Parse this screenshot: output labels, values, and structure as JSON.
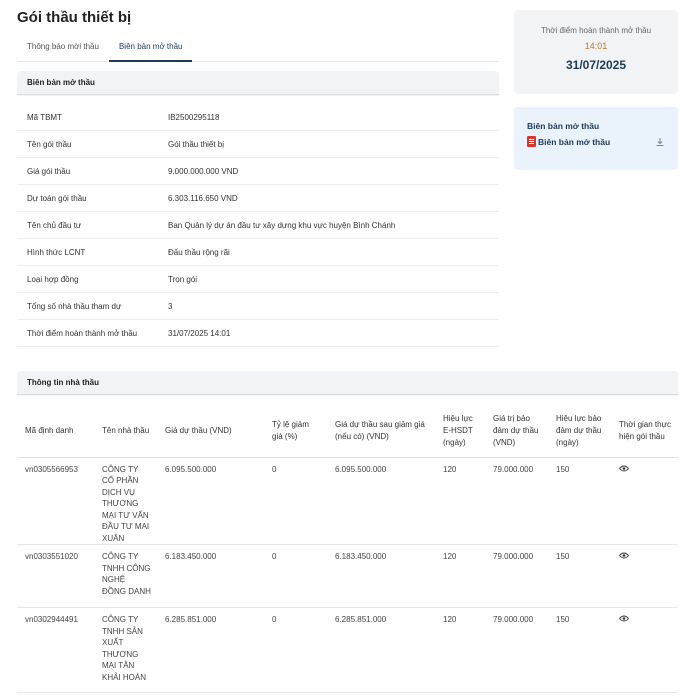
{
  "page_title": "Gói thầu thiết bị",
  "tabs": [
    {
      "label": "Thông báo mời thầu",
      "active": false
    },
    {
      "label": "Biên bản mở thầu",
      "active": true
    }
  ],
  "minutes_section": {
    "title": "Biên bản mở thầu",
    "rows": [
      {
        "label": "Mã TBMT",
        "value": "IB2500295118"
      },
      {
        "label": "Tên gói thầu",
        "value": "Gói thầu thiết bị"
      },
      {
        "label": "Giá gói thầu",
        "value": "9.000.000.000 VND"
      },
      {
        "label": "Dự toán gói thầu",
        "value": "6.303.116.650 VND"
      },
      {
        "label": "Tên chủ đầu tư",
        "value": "Ban Quản lý dự án đầu tư xây dựng khu vực huyện Bình Chánh"
      },
      {
        "label": "Hình thức LCNT",
        "value": "Đấu thầu rộng rãi"
      },
      {
        "label": "Loại hợp đồng",
        "value": "Trọn gói"
      },
      {
        "label": "Tổng số nhà thầu tham dự",
        "value": "3"
      },
      {
        "label": "Thời điểm hoàn thành mở thầu",
        "value": "31/07/2025 14:01"
      }
    ]
  },
  "completion_card": {
    "label": "Thời điểm hoàn thành mở thầu",
    "time": "14:01",
    "date": "31/07/2025",
    "time_color": "#c27a2c",
    "date_color": "#1c3b5a"
  },
  "document_card": {
    "title": "Biên bản mở thầu",
    "file_label": "Biên bản mở thầu",
    "file_icon": "pdf-icon",
    "action_icon": "download-icon"
  },
  "bidders_section": {
    "title": "Thông tin nhà thầu",
    "columns": [
      "Mã định danh",
      "Tên nhà thầu",
      "Giá dự thầu (VND)",
      "Tỷ lệ giảm giá (%)",
      "Giá dự thầu sau giảm giá (nếu có) (VND)",
      "Hiệu lực E-HSDT (ngày)",
      "Giá trị bảo đảm dự thầu (VND)",
      "Hiệu lực bảo đảm dự thầu (ngày)",
      "Thời gian thực hiện gói thầu"
    ],
    "rows": [
      {
        "id": "vn0305566953",
        "name": "CÔNG TY CỔ PHẦN DỊCH VỤ THƯƠNG MẠI TƯ VẤN ĐẦU TƯ MAI XUÂN",
        "bid_price": "6.095.500.000",
        "discount": "0",
        "price_after_discount": "6.095.500.000",
        "validity": "120",
        "guarantee_value": "79.000.000",
        "guarantee_validity": "150"
      },
      {
        "id": "vn0303551020",
        "name": "CÔNG TY TNHH CÔNG NGHỆ ĐỒNG DANH",
        "bid_price": "6.183.450.000",
        "discount": "0",
        "price_after_discount": "6.183.450.000",
        "validity": "120",
        "guarantee_value": "79.000.000",
        "guarantee_validity": "150"
      },
      {
        "id": "vn0302944491",
        "name": "CÔNG TY TNHH SẢN XUẤT THƯƠNG MẠI TÂN KHẢI HOÀN",
        "bid_price": "6.285.851.000",
        "discount": "0",
        "price_after_discount": "6.285.851.000",
        "validity": "120",
        "guarantee_value": "79.000.000",
        "guarantee_validity": "150"
      }
    ],
    "row_action_icon": "eye-icon"
  }
}
